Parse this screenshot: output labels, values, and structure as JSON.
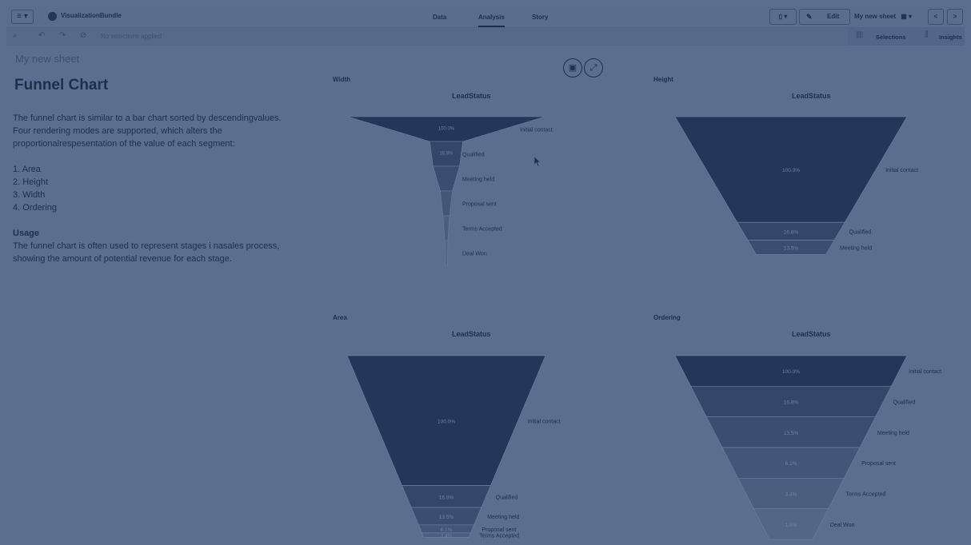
{
  "topbar": {
    "menu_label": "≡ ▾",
    "app_name": "VisualizationBundle",
    "tabs": [
      "Data",
      "Analysis",
      "Story"
    ],
    "active_tab": "Analysis",
    "bookmark_label": "▯ ▾",
    "edit_label": "Edit",
    "sheet_selector": "My new sheet",
    "prev_label": "<",
    "next_label": ">"
  },
  "selection_bar": {
    "no_selections": "No selections applied",
    "selections_label": "Selections",
    "insights_label": "Insights"
  },
  "sheet": {
    "name": "My new sheet"
  },
  "text_panel": {
    "title": "Funnel Chart",
    "intro": "The funnel chart is similar to a bar chart sorted by descendingvalues. Four rendering modes are supported, which alters the proportionalrespesentation of the value of each segment:",
    "modes": [
      "1. Area",
      "2. Height",
      "3. Width",
      "4. Ordering"
    ],
    "usage_heading": "Usage",
    "usage_text": "The funnel chart is often used to represent stages i nasales process, showing the amount of potential revenue for each stage."
  },
  "colors": {
    "background": "#5b6e8f",
    "text": "#1e2f4b",
    "funnel_dark": "#24365a"
  },
  "chart_data": [
    {
      "type": "funnel",
      "mode": "width",
      "title": "Width",
      "dimension": "LeadStatus",
      "categories": [
        "Initial contact",
        "Qualified",
        "Meeting held",
        "Proposal sent",
        "Terms Accepted",
        "Deal Won"
      ],
      "values": [
        100.0,
        16.8,
        13.5,
        6.1,
        3.4,
        1.6
      ],
      "labels": [
        "100.0%",
        "16.8%",
        "",
        "",
        "",
        ""
      ]
    },
    {
      "type": "funnel",
      "mode": "height",
      "title": "Height",
      "dimension": "LeadStatus",
      "categories": [
        "Initial contact",
        "Qualified",
        "Meeting held"
      ],
      "values": [
        100.0,
        16.8,
        13.5,
        6.1,
        3.4,
        1.6
      ],
      "labels": [
        "100.0%",
        "16.8%",
        "13.5%"
      ]
    },
    {
      "type": "funnel",
      "mode": "area",
      "title": "Area",
      "dimension": "LeadStatus",
      "categories": [
        "Initial contact",
        "Qualified",
        "Meeting held",
        "Proposal sent",
        "Terms Accepted"
      ],
      "values": [
        100.0,
        16.8,
        13.5,
        6.1,
        3.4,
        1.6
      ],
      "labels": [
        "100.0%",
        "16.8%",
        "13.5%",
        "6.1%",
        "3.4%"
      ]
    },
    {
      "type": "funnel",
      "mode": "ordering",
      "title": "Ordering",
      "dimension": "LeadStatus",
      "categories": [
        "Initial contact",
        "Qualified",
        "Meeting held",
        "Proposal sent",
        "Terms Accepted",
        "Deal Won"
      ],
      "values": [
        100.0,
        16.8,
        13.5,
        6.1,
        3.4,
        1.6
      ],
      "labels": [
        "100.0%",
        "16.8%",
        "13.5%",
        "6.1%",
        "3.4%",
        "1.6%"
      ]
    }
  ]
}
